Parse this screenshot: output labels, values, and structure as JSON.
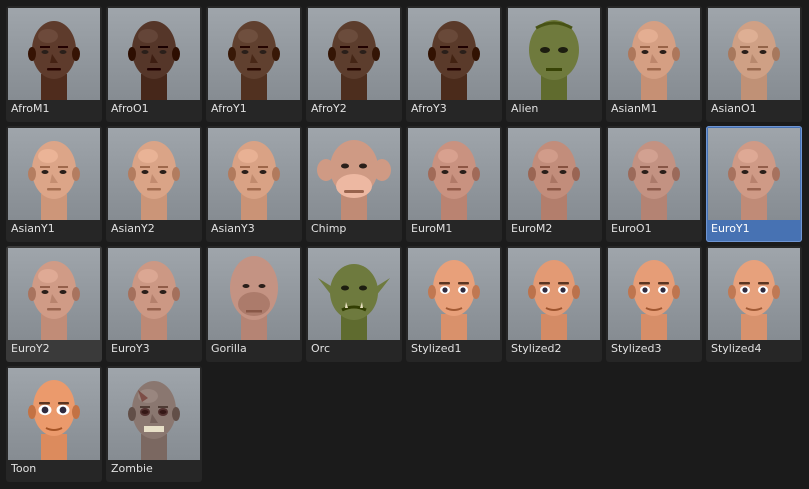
{
  "colors": {
    "background": "#1b1b1b",
    "tile": "#262626",
    "tile_hover": "#3a3a3a",
    "selected": "#4772b3",
    "thumbnail_bg": "#969ca2",
    "label": "#e1e1e1"
  },
  "selected_preset": "EuroY1",
  "hovered_preset": "EuroY2",
  "presets": [
    {
      "label": "AfroM1",
      "skin": "#5e3b2c",
      "style": "human"
    },
    {
      "label": "AfroO1",
      "skin": "#553629",
      "style": "human"
    },
    {
      "label": "AfroY1",
      "skin": "#60402f",
      "style": "human"
    },
    {
      "label": "AfroY2",
      "skin": "#5c3d2d",
      "style": "human"
    },
    {
      "label": "AfroY3",
      "skin": "#5a3a2a",
      "style": "human"
    },
    {
      "label": "Alien",
      "skin": "#6f7a3d",
      "style": "alien"
    },
    {
      "label": "AsianM1",
      "skin": "#d59f83",
      "style": "human"
    },
    {
      "label": "AsianO1",
      "skin": "#cfa085",
      "style": "human"
    },
    {
      "label": "AsianY1",
      "skin": "#dca588",
      "style": "human"
    },
    {
      "label": "AsianY2",
      "skin": "#daa487",
      "style": "human"
    },
    {
      "label": "AsianY3",
      "skin": "#d9a285",
      "style": "human"
    },
    {
      "label": "Chimp",
      "skin": "#cf9a84",
      "style": "chimp"
    },
    {
      "label": "EuroM1",
      "skin": "#c99280",
      "style": "human"
    },
    {
      "label": "EuroM2",
      "skin": "#c28d7b",
      "style": "human"
    },
    {
      "label": "EuroO1",
      "skin": "#c39282",
      "style": "human"
    },
    {
      "label": "EuroY1",
      "skin": "#cf9a86",
      "style": "human"
    },
    {
      "label": "EuroY2",
      "skin": "#d09b86",
      "style": "human"
    },
    {
      "label": "EuroY3",
      "skin": "#cc9884",
      "style": "human"
    },
    {
      "label": "Gorilla",
      "skin": "#c49383",
      "style": "gorilla"
    },
    {
      "label": "Orc",
      "skin": "#6e7a3e",
      "style": "orc"
    },
    {
      "label": "Stylized1",
      "skin": "#e8a07a",
      "style": "stylized"
    },
    {
      "label": "Stylized2",
      "skin": "#e39a74",
      "style": "stylized"
    },
    {
      "label": "Stylized3",
      "skin": "#e69d77",
      "style": "stylized"
    },
    {
      "label": "Stylized4",
      "skin": "#e7a17c",
      "style": "stylized"
    },
    {
      "label": "Toon",
      "skin": "#eb9a6c",
      "style": "toon"
    },
    {
      "label": "Zombie",
      "skin": "#8a7770",
      "style": "zombie"
    }
  ]
}
